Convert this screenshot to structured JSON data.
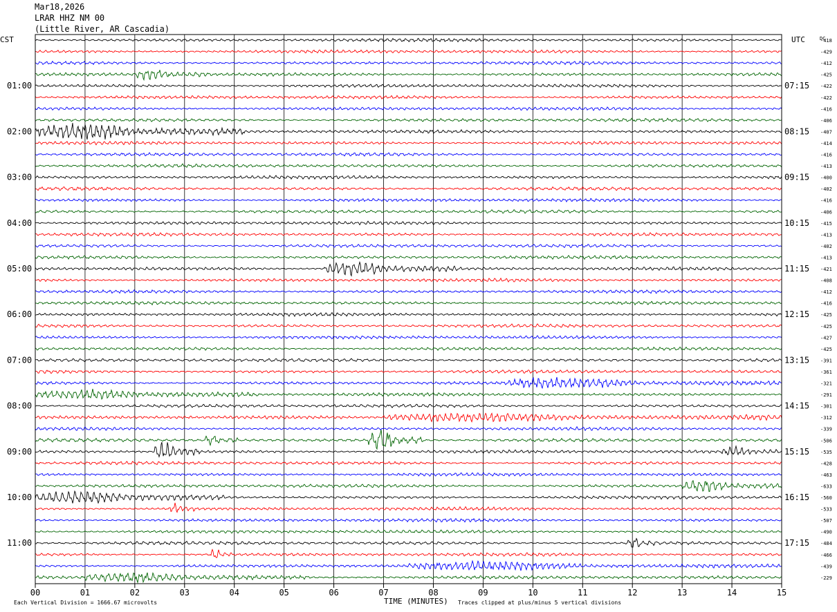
{
  "header": {
    "date": "Mar18,2026",
    "station": "LRAR HHZ NM 00",
    "location": "(Little River, AR Cascadia)"
  },
  "left_zone": "CST",
  "right_zone": "UTC",
  "dc_label": "DC",
  "footer": {
    "scale_note": "Each Vertical Division = 1666.67 microvolts",
    "xlabel": "TIME (MINUTES)",
    "clip_note": "Traces clipped at plus/minus 5 vertical divisions"
  },
  "chart_data": {
    "type": "line",
    "xlabel": "TIME (MINUTES)",
    "xlim": [
      0,
      15
    ],
    "x_ticks": [
      "00",
      "01",
      "02",
      "03",
      "04",
      "05",
      "06",
      "07",
      "08",
      "09",
      "10",
      "11",
      "12",
      "13",
      "14",
      "15"
    ],
    "cst_hour_labels": [
      "01:00",
      "02:00",
      "03:00",
      "04:00",
      "05:00",
      "06:00",
      "07:00",
      "08:00",
      "09:00",
      "10:00",
      "11:00"
    ],
    "utc_hour_labels": [
      "07:15",
      "08:15",
      "09:15",
      "10:15",
      "11:15",
      "12:15",
      "13:15",
      "14:15",
      "15:15",
      "16:15",
      "17:15"
    ],
    "trace_colors": [
      "#000000",
      "#ff0000",
      "#0000ff",
      "#006400"
    ],
    "dc_offsets": [
      "-418",
      "-429",
      "-412",
      "-425",
      "-422",
      "-422",
      "-416",
      "-406",
      "-407",
      "-414",
      "-416",
      "-413",
      "-400",
      "-402",
      "-416",
      "-406",
      "-415",
      "-413",
      "-402",
      "-413",
      "-421",
      "-408",
      "-412",
      "-416",
      "-425",
      "-425",
      "-427",
      "-425",
      "-391",
      "-361",
      "-321",
      "-291",
      "-301",
      "-312",
      "-339",
      "-506",
      "-535",
      "-428",
      "-463",
      "-633",
      "-560",
      "-533",
      "-507",
      "-490",
      "-484",
      "-466",
      "-439",
      "-229"
    ],
    "traces_per_hour": 4,
    "trace_minutes": 15,
    "events": [
      {
        "trace": 8,
        "start_min": 0.0,
        "end_min": 4.2,
        "amp": 3.2
      },
      {
        "trace": 3,
        "start_min": 2.0,
        "end_min": 3.5,
        "amp": 1.8
      },
      {
        "trace": 20,
        "start_min": 5.8,
        "end_min": 8.5,
        "amp": 2.8
      },
      {
        "trace": 31,
        "start_min": 0.0,
        "end_min": 4.5,
        "amp": 1.8
      },
      {
        "trace": 30,
        "start_min": 9.5,
        "end_min": 15.0,
        "amp": 1.6
      },
      {
        "trace": 33,
        "start_min": 7.0,
        "end_min": 15.0,
        "amp": 1.6
      },
      {
        "trace": 35,
        "start_min": 6.7,
        "end_min": 7.8,
        "amp": 4.5
      },
      {
        "trace": 36,
        "start_min": 2.4,
        "end_min": 3.3,
        "amp": 4.0
      },
      {
        "trace": 35,
        "start_min": 3.4,
        "end_min": 4.1,
        "amp": 2.0
      },
      {
        "trace": 40,
        "start_min": 0.0,
        "end_min": 3.8,
        "amp": 2.2
      },
      {
        "trace": 41,
        "start_min": 2.7,
        "end_min": 3.2,
        "amp": 2.0
      },
      {
        "trace": 39,
        "start_min": 13.0,
        "end_min": 15.0,
        "amp": 2.2
      },
      {
        "trace": 36,
        "start_min": 13.8,
        "end_min": 15.0,
        "amp": 1.5
      },
      {
        "trace": 44,
        "start_min": 11.9,
        "end_min": 12.5,
        "amp": 2.0
      },
      {
        "trace": 45,
        "start_min": 3.5,
        "end_min": 4.0,
        "amp": 2.0
      },
      {
        "trace": 46,
        "start_min": 7.5,
        "end_min": 15.0,
        "amp": 1.3
      },
      {
        "trace": 47,
        "start_min": 1.0,
        "end_min": 5.5,
        "amp": 1.6
      }
    ]
  }
}
